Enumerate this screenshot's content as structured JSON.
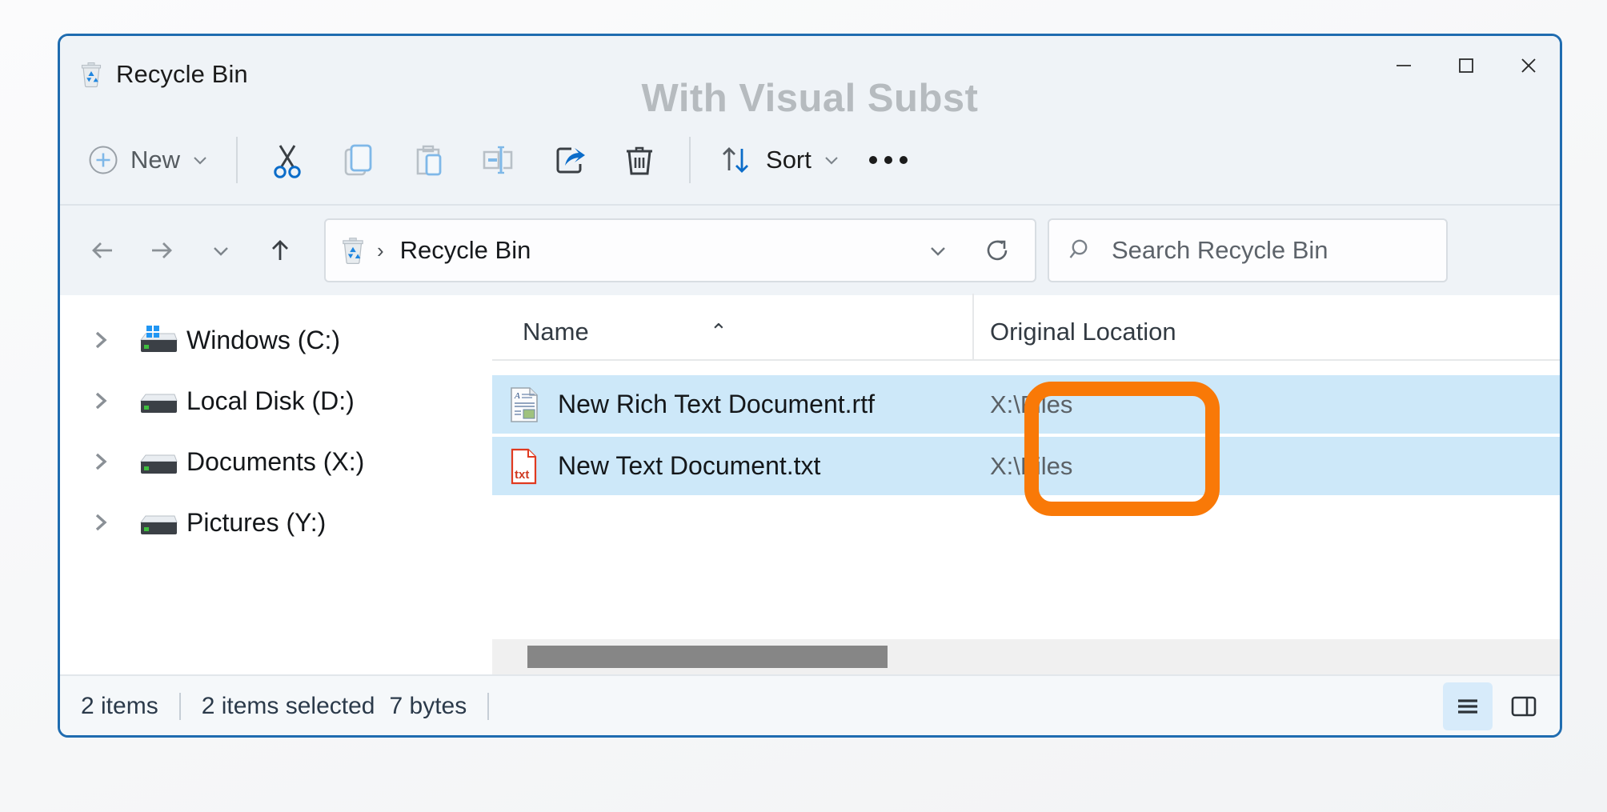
{
  "window": {
    "title": "Recycle Bin",
    "title_icon": "recycle-bin-icon",
    "overlay_label": "With Visual Subst",
    "border_color": "#1f6cb0",
    "controls": {
      "minimize": "─",
      "maximize": "☐",
      "close": "✕"
    }
  },
  "command_bar": {
    "new_label": "New",
    "new_icon": "plus-circle-icon",
    "new_chevron": "⌄",
    "cut_icon": "scissors-icon",
    "copy_icon": "copy-icon",
    "paste_icon": "paste-icon",
    "rename_icon": "rename-icon",
    "share_icon": "share-icon",
    "delete_icon": "trash-icon",
    "sort_label": "Sort",
    "sort_icon": "sort-arrows-icon",
    "sort_chevron": "⌄",
    "more_label": "•••"
  },
  "nav_bar": {
    "back_icon": "arrow-left-icon",
    "forward_icon": "arrow-right-icon",
    "recent_chevron_icon": "chevron-down-icon",
    "up_icon": "arrow-up-icon",
    "breadcrumb": {
      "icon": "recycle-bin-icon",
      "separator": "›",
      "path": "Recycle Bin"
    },
    "address_chevron_icon": "chevron-down-icon",
    "refresh_icon": "refresh-icon",
    "search": {
      "icon": "search-icon",
      "placeholder": "Search Recycle Bin",
      "value": ""
    }
  },
  "sidebar": {
    "items": [
      {
        "label": "Windows (C:)",
        "icon": "drive-windows-icon",
        "chevron": "›",
        "expanded": false
      },
      {
        "label": "Local Disk (D:)",
        "icon": "drive-icon",
        "chevron": "›",
        "expanded": false
      },
      {
        "label": "Documents (X:)",
        "icon": "drive-icon",
        "chevron": "›",
        "expanded": false
      },
      {
        "label": "Pictures (Y:)",
        "icon": "drive-icon",
        "chevron": "›",
        "expanded": false
      }
    ]
  },
  "file_list": {
    "columns": [
      {
        "key": "name",
        "label": "Name",
        "sorted": "ascending",
        "sort_caret": "⌃"
      },
      {
        "key": "original_location",
        "label": "Original Location",
        "sorted": "none"
      }
    ],
    "rows": [
      {
        "name": "New Rich Text Document.rtf",
        "icon": "rtf-file-icon",
        "original_location": "X:\\Files",
        "selected": true
      },
      {
        "name": "New Text Document.txt",
        "icon": "txt-file-icon",
        "original_location": "X:\\Files",
        "selected": true
      }
    ],
    "selection_color": "#cde8f9"
  },
  "status_bar": {
    "item_count": "2 items",
    "selection_count": "2 items selected",
    "selection_size": "7 bytes",
    "views": [
      {
        "name": "details-view",
        "icon": "list-lines-icon",
        "active": true
      },
      {
        "name": "preview-pane",
        "icon": "preview-pane-icon",
        "active": false
      }
    ]
  },
  "annotation": {
    "type": "rounded-rectangle-highlight",
    "color": "#f97907",
    "targets": [
      "X:\\Files",
      "X:\\Files"
    ]
  }
}
